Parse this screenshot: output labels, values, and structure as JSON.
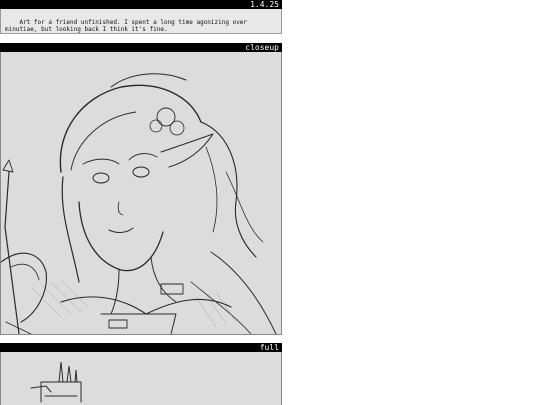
{
  "post": {
    "version": "1.4.25",
    "caption": "Art for a friend unfinished. I spent a long time agonizing over minutiae, but looking back I think it's fine."
  },
  "panels": [
    {
      "label": "closeup"
    },
    {
      "label": "full"
    }
  ]
}
